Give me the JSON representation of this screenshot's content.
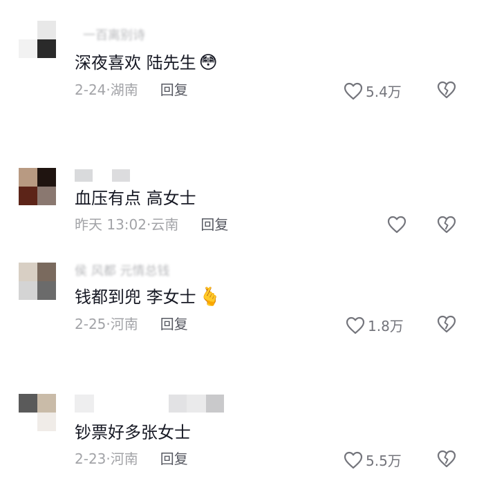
{
  "comments": [
    {
      "username": "一百离别诗",
      "text": "深夜喜欢  陆先生",
      "emoji": "😳",
      "date": "2-24",
      "location": "湖南",
      "reply_label": "回复",
      "likes": "5.4万",
      "liked": false
    },
    {
      "username": "",
      "text": "血压有点  高女士",
      "emoji": "",
      "date": "昨天 13:02",
      "location": "云南",
      "reply_label": "回复",
      "likes": "",
      "liked": false
    },
    {
      "username": "侯 风都 元情总钱",
      "text": "钱都到兜  李女士",
      "emoji": "🫰",
      "date": "2-25",
      "location": "河南",
      "reply_label": "回复",
      "likes": "1.8万",
      "liked": false
    },
    {
      "username": "",
      "text": "钞票好多张女士",
      "emoji": "",
      "date": "2-23",
      "location": "河南",
      "reply_label": "回复",
      "likes": "5.5万",
      "liked": false
    }
  ],
  "separator": "·",
  "colors": {
    "text": "#161823",
    "meta": "#a2a3a7",
    "reply": "#565861",
    "icon": "#73747b"
  },
  "icons": {
    "like": "heart-outline-icon",
    "dislike": "broken-heart-icon"
  }
}
